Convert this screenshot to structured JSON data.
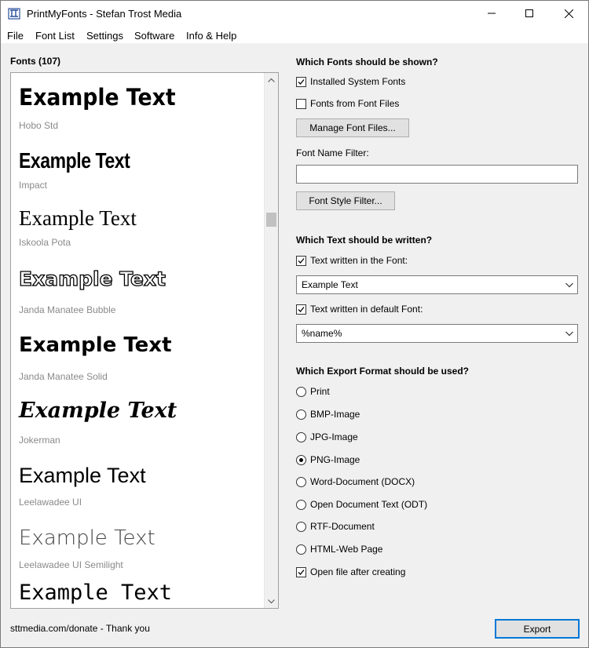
{
  "window": {
    "title": "PrintMyFonts - Stefan Trost Media"
  },
  "menu": [
    "File",
    "Font List",
    "Settings",
    "Software",
    "Info & Help"
  ],
  "fonts_label": "Fonts (107)",
  "font_list": [
    {
      "sample": "Example Text",
      "name": "Hobo Std"
    },
    {
      "sample": "Example Text",
      "name": "Impact"
    },
    {
      "sample": "Example Text",
      "name": "Iskoola Pota"
    },
    {
      "sample": "Example Text",
      "name": "Janda Manatee Bubble"
    },
    {
      "sample": "Example Text",
      "name": "Janda Manatee Solid"
    },
    {
      "sample": "Example Text",
      "name": "Jokerman"
    },
    {
      "sample": "Example Text",
      "name": "Leelawadee UI"
    },
    {
      "sample": "Example Text",
      "name": "Leelawadee UI Semilight"
    },
    {
      "sample": "Example Text",
      "name": ""
    }
  ],
  "fonts_shown": {
    "title": "Which Fonts should be shown?",
    "installed_label": "Installed System Fonts",
    "installed_checked": true,
    "from_files_label": "Fonts from Font Files",
    "from_files_checked": false,
    "manage_button": "Manage Font Files...",
    "name_filter_label": "Font Name Filter:",
    "name_filter_value": "",
    "style_filter_button": "Font Style Filter..."
  },
  "text_written": {
    "title": "Which Text should be written?",
    "in_font_label": "Text written in the Font:",
    "in_font_checked": true,
    "in_font_value": "Example Text",
    "default_font_label": "Text written in default Font:",
    "default_font_checked": true,
    "default_font_value": "%name%"
  },
  "export": {
    "title": "Which Export Format should be used?",
    "options": [
      "Print",
      "BMP-Image",
      "JPG-Image",
      "PNG-Image",
      "Word-Document (DOCX)",
      "Open Document Text (ODT)",
      "RTF-Document",
      "HTML-Web Page"
    ],
    "selected": "PNG-Image",
    "open_after_label": "Open file after creating",
    "open_after_checked": true,
    "export_button": "Export"
  },
  "status_text": "sttmedia.com/donate - Thank you",
  "colors": {
    "accent": "#0078d7",
    "background": "#f0f0f0",
    "font_name_gray": "#8a8a8a"
  }
}
